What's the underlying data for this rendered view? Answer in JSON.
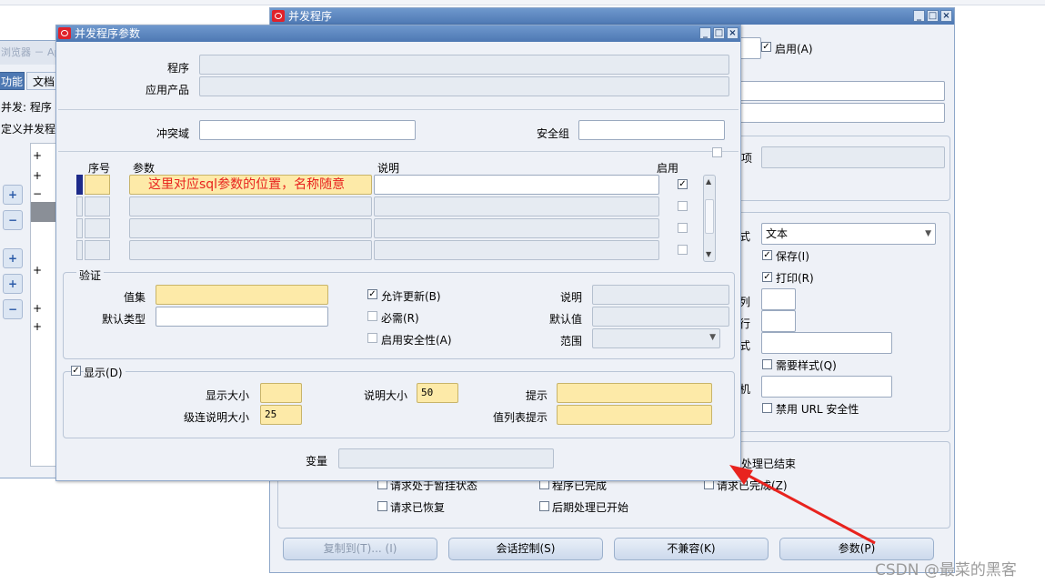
{
  "navigator": {
    "title": "浏览器 － Ap",
    "tabs": [
      "功能",
      "文档"
    ],
    "line1": "并发: 程序",
    "line2": "定义并发程",
    "tree_plus": [
      "+",
      "+",
      "−",
      "+",
      "+",
      "+"
    ]
  },
  "concurrent_program": {
    "title": "并发程序",
    "enabled_label": "启用(A)",
    "right_labels": {
      "item": "项",
      "style": "式",
      "column": "列",
      "row": "行",
      "format": "式",
      "printer": "机"
    },
    "output_format": "文本",
    "save_label": "保存(I)",
    "print_label": "打印(R)",
    "require_style_label": "需要样式(Q)",
    "disable_url_label": "禁用 URL 安全性",
    "status_labels": [
      "处理已结束",
      "请求处于暂挂状态",
      "程序已完成",
      "请求已完成(Z)",
      "请求已恢复",
      "后期处理已开始"
    ],
    "buttons": [
      "复制到(T)... (I)",
      "会话控制(S)",
      "不兼容(K)",
      "参数(P)"
    ]
  },
  "params_dialog": {
    "title": "并发程序参数",
    "program_label": "程序",
    "app_label": "应用产品",
    "conflict_label": "冲突域",
    "security_label": "安全组",
    "col_seq": "序号",
    "col_param": "参数",
    "col_desc": "说明",
    "col_enabled": "启用",
    "first_param": "这里对应sql参数的位置，名称随意",
    "validation_label": "验证",
    "valueset_label": "值集",
    "default_type_label": "默认类型",
    "allow_update_label": "允许更新(B)",
    "required_label": "必需(R)",
    "enable_security_label": "启用安全性(A)",
    "desc_label": "说明",
    "default_value_label": "默认值",
    "range_label": "范围",
    "display_label": "显示(D)",
    "display_size_label": "显示大小",
    "desc_size_label": "说明大小",
    "desc_size_value": "50",
    "prompt_label": "提示",
    "concat_desc_size_label": "级连说明大小",
    "concat_desc_size_value": "25",
    "value_list_prompt_label": "值列表提示",
    "variable_label": "变量"
  },
  "watermark": "CSDN @最菜的黑客",
  "colors": {
    "accent": "#4d78b3",
    "required": "#fdeaa8",
    "annotation": "#e8231e"
  }
}
